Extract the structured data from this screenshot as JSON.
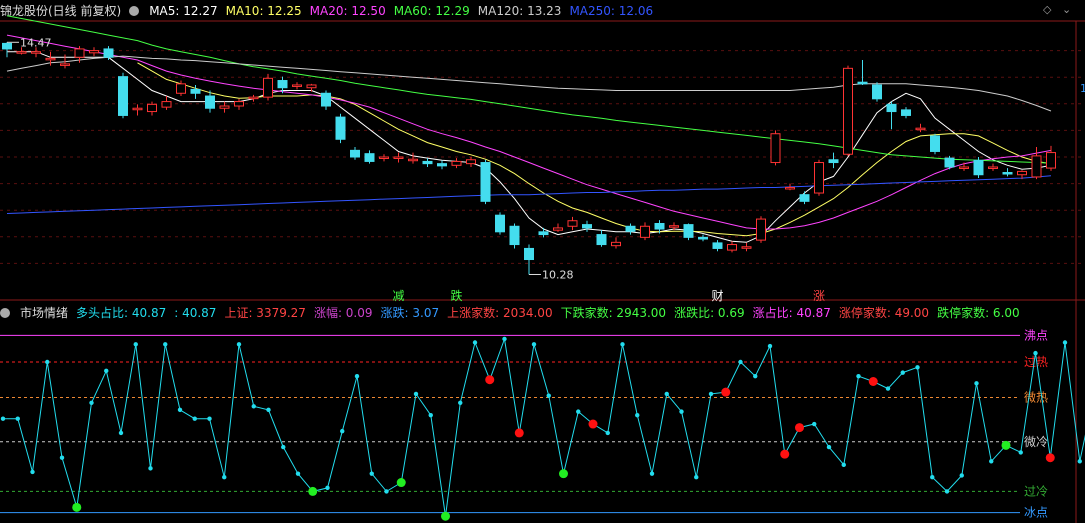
{
  "top": {
    "title": "锦龙股份(日线 前复权)",
    "ma": [
      {
        "label": "MA5: 12.27",
        "color": "#ffffff"
      },
      {
        "label": "MA10: 12.25",
        "color": "#ffff66"
      },
      {
        "label": "MA20: 12.50",
        "color": "#ff44ff"
      },
      {
        "label": "MA60: 12.29",
        "color": "#44ff44"
      },
      {
        "label": "MA120: 13.23",
        "color": "#cccccc"
      },
      {
        "label": "MA250: 12.06",
        "color": "#3355ff"
      }
    ],
    "high_label": "14.47",
    "low_label": "10.28",
    "events": [
      {
        "label": "减",
        "color": "#44ff44",
        "bar": 27
      },
      {
        "label": "跌",
        "color": "#44ff44",
        "bar": 31
      },
      {
        "label": "财",
        "color": "#ffffff",
        "bar": 49
      },
      {
        "label": "涨",
        "color": "#ff4444",
        "bar": 56
      }
    ],
    "right_marker": "1"
  },
  "bottom": {
    "title": "市场情绪",
    "stats": [
      {
        "label": "多头占比: 40.87",
        "color": "#22ddee"
      },
      {
        "label": ": 40.87",
        "color": "#22ddee"
      },
      {
        "label": "上证: 3379.27",
        "color": "#ff4444"
      },
      {
        "label": "涨幅: 0.09",
        "color": "#cc44cc"
      },
      {
        "label": "涨跌: 3.07",
        "color": "#3399ff"
      },
      {
        "label": "上涨家数: 2034.00",
        "color": "#ff4444"
      },
      {
        "label": "下跌家数: 2943.00",
        "color": "#44ff44"
      },
      {
        "label": "涨跌比: 0.69",
        "color": "#44ff44"
      },
      {
        "label": "涨占比: 40.87",
        "color": "#ff44ff"
      },
      {
        "label": "涨停家数: 49.00",
        "color": "#ff4444"
      },
      {
        "label": "跌停家数: 6.00",
        "color": "#44ff44"
      }
    ],
    "levels": [
      {
        "label": "沸点",
        "value": 100,
        "color": "#ff44ff"
      },
      {
        "label": "过热",
        "value": 85,
        "color": "#ff2222"
      },
      {
        "label": "微热",
        "value": 65,
        "color": "#ee8833"
      },
      {
        "label": "微冷",
        "value": 40,
        "color": "#cccccc"
      },
      {
        "label": "过冷",
        "value": 12,
        "color": "#33aa33"
      },
      {
        "label": "冰点",
        "value": 0,
        "color": "#3399ff"
      }
    ]
  },
  "chart_data": [
    {
      "type": "candlestick",
      "ylim": [
        10.0,
        14.8
      ],
      "labels": {
        "high": "14.47",
        "low": "10.28"
      },
      "candles": [
        [
          14.45,
          14.35,
          14.47,
          14.2
        ],
        [
          14.3,
          14.3,
          14.38,
          14.25
        ],
        [
          14.3,
          14.3,
          14.38,
          14.2
        ],
        [
          14.18,
          14.18,
          14.3,
          14.05
        ],
        [
          14.08,
          14.08,
          14.25,
          14.0
        ],
        [
          14.2,
          14.35,
          14.4,
          14.1
        ],
        [
          14.28,
          14.32,
          14.38,
          14.22
        ],
        [
          14.35,
          14.2,
          14.4,
          14.15
        ],
        [
          13.85,
          13.15,
          13.92,
          13.1
        ],
        [
          13.28,
          13.28,
          13.35,
          13.15
        ],
        [
          13.22,
          13.35,
          13.4,
          13.15
        ],
        [
          13.3,
          13.4,
          13.5,
          13.25
        ],
        [
          13.55,
          13.72,
          13.78,
          13.5
        ],
        [
          13.62,
          13.55,
          13.7,
          13.45
        ],
        [
          13.5,
          13.28,
          13.6,
          13.2
        ],
        [
          13.28,
          13.32,
          13.4,
          13.2
        ],
        [
          13.32,
          13.4,
          13.45,
          13.25
        ],
        [
          13.48,
          13.48,
          13.52,
          13.4
        ],
        [
          13.48,
          13.82,
          13.9,
          13.42
        ],
        [
          13.78,
          13.65,
          13.85,
          13.55
        ],
        [
          13.7,
          13.7,
          13.75,
          13.62
        ],
        [
          13.65,
          13.7,
          13.72,
          13.58
        ],
        [
          13.55,
          13.32,
          13.6,
          13.25
        ],
        [
          13.12,
          12.72,
          13.18,
          12.65
        ],
        [
          12.52,
          12.4,
          12.58,
          12.35
        ],
        [
          12.46,
          12.32,
          12.52,
          12.28
        ],
        [
          12.38,
          12.4,
          12.45,
          12.32
        ],
        [
          12.4,
          12.4,
          12.48,
          12.3
        ],
        [
          12.36,
          12.36,
          12.48,
          12.28
        ],
        [
          12.32,
          12.28,
          12.38,
          12.22
        ],
        [
          12.28,
          12.24,
          12.34,
          12.18
        ],
        [
          12.25,
          12.32,
          12.38,
          12.2
        ],
        [
          12.28,
          12.35,
          12.4,
          12.22
        ],
        [
          12.3,
          11.6,
          12.35,
          11.55
        ],
        [
          11.35,
          11.05,
          11.4,
          11.0
        ],
        [
          11.15,
          10.82,
          11.2,
          10.75
        ],
        [
          10.75,
          10.55,
          10.82,
          10.28
        ],
        [
          11.05,
          11.0,
          11.12,
          10.95
        ],
        [
          11.08,
          11.12,
          11.2,
          11.05
        ],
        [
          11.15,
          11.25,
          11.32,
          11.08
        ],
        [
          11.18,
          11.12,
          11.25,
          11.05
        ],
        [
          11.0,
          10.82,
          11.08,
          10.78
        ],
        [
          10.8,
          10.86,
          10.95,
          10.75
        ],
        [
          11.15,
          11.06,
          11.2,
          11.0
        ],
        [
          10.95,
          11.15,
          11.22,
          10.9
        ],
        [
          11.2,
          11.1,
          11.26,
          11.02
        ],
        [
          11.15,
          11.16,
          11.22,
          11.08
        ],
        [
          11.18,
          10.95,
          11.2,
          10.9
        ],
        [
          10.95,
          10.92,
          11.0,
          10.88
        ],
        [
          10.85,
          10.75,
          10.9,
          10.7
        ],
        [
          10.72,
          10.82,
          10.88,
          10.68
        ],
        [
          10.76,
          10.78,
          10.85,
          10.7
        ],
        [
          10.9,
          11.28,
          11.33,
          10.85
        ],
        [
          12.3,
          12.82,
          12.88,
          12.25
        ],
        [
          11.85,
          11.85,
          11.92,
          11.8
        ],
        [
          11.72,
          11.6,
          11.78,
          11.55
        ],
        [
          11.75,
          12.3,
          12.35,
          11.7
        ],
        [
          12.35,
          12.3,
          12.48,
          12.2
        ],
        [
          12.45,
          14.0,
          14.05,
          12.42
        ],
        [
          13.75,
          13.72,
          14.15,
          13.7
        ],
        [
          13.7,
          13.45,
          13.75,
          13.4
        ],
        [
          13.35,
          13.22,
          13.4,
          12.9
        ],
        [
          13.25,
          13.15,
          13.3,
          13.1
        ],
        [
          12.92,
          12.92,
          13.0,
          12.85
        ],
        [
          12.78,
          12.5,
          12.82,
          12.45
        ],
        [
          12.38,
          12.22,
          12.42,
          12.18
        ],
        [
          12.22,
          12.22,
          12.3,
          12.15
        ],
        [
          12.34,
          12.08,
          12.4,
          12.02
        ],
        [
          12.2,
          12.22,
          12.28,
          12.15
        ],
        [
          12.12,
          12.1,
          12.2,
          12.05
        ],
        [
          12.08,
          12.14,
          12.16,
          12.0
        ],
        [
          12.04,
          12.42,
          12.58,
          12.0
        ],
        [
          12.2,
          12.48,
          12.6,
          12.15
        ]
      ],
      "ma_series": [
        {
          "name": "MA5",
          "color": "#ffffff",
          "values": [
            14.3,
            14.3,
            14.3,
            14.2,
            14.2,
            14.2,
            14.2,
            14.2,
            14.0,
            13.8,
            13.6,
            13.5,
            13.4,
            13.4,
            13.4,
            13.4,
            13.4,
            13.45,
            13.55,
            13.6,
            13.6,
            13.6,
            13.5,
            13.3,
            13.1,
            12.9,
            12.7,
            12.5,
            12.42,
            12.38,
            12.34,
            12.32,
            12.3,
            12.2,
            11.95,
            11.65,
            11.3,
            11.1,
            11.0,
            11.05,
            11.1,
            11.08,
            11.05,
            11.05,
            11.02,
            11.05,
            11.1,
            11.08,
            11.02,
            10.95,
            10.88,
            10.86,
            10.98,
            11.25,
            11.5,
            11.75,
            11.95,
            12.05,
            12.4,
            12.8,
            13.2,
            13.4,
            13.55,
            13.45,
            13.1,
            12.9,
            12.7,
            12.5,
            12.35,
            12.25,
            12.18,
            12.2,
            12.25
          ]
        },
        {
          "name": "MA10",
          "color": "#ffff66",
          "values": [
            null,
            null,
            null,
            null,
            null,
            null,
            null,
            null,
            null,
            14.1,
            13.95,
            13.8,
            13.72,
            13.64,
            13.56,
            13.5,
            13.46,
            13.47,
            13.5,
            13.5,
            13.5,
            13.52,
            13.5,
            13.45,
            13.35,
            13.2,
            13.05,
            12.9,
            12.78,
            12.66,
            12.58,
            12.5,
            12.44,
            12.36,
            12.25,
            12.1,
            11.92,
            11.75,
            11.6,
            11.48,
            11.4,
            11.3,
            11.2,
            11.12,
            11.06,
            11.05,
            11.06,
            11.06,
            11.05,
            11.02,
            11.0,
            10.98,
            11.02,
            11.1,
            11.22,
            11.35,
            11.5,
            11.65,
            11.85,
            12.08,
            12.3,
            12.5,
            12.68,
            12.78,
            12.8,
            12.82,
            12.82,
            12.78,
            12.65,
            12.52,
            12.4,
            12.32,
            12.28
          ]
        },
        {
          "name": "MA20",
          "color": "#ff44ff",
          "values": [
            14.6,
            14.55,
            14.5,
            14.45,
            14.4,
            14.35,
            14.3,
            14.25,
            14.2,
            14.15,
            14.05,
            13.95,
            13.88,
            13.82,
            13.77,
            13.72,
            13.68,
            13.64,
            13.61,
            13.58,
            13.55,
            13.52,
            13.48,
            13.43,
            13.37,
            13.3,
            13.2,
            13.1,
            13.0,
            12.9,
            12.82,
            12.75,
            12.67,
            12.58,
            12.5,
            12.4,
            12.3,
            12.2,
            12.1,
            12.0,
            11.9,
            11.82,
            11.74,
            11.66,
            11.58,
            11.5,
            11.42,
            11.36,
            11.3,
            11.24,
            11.18,
            11.12,
            11.1,
            11.1,
            11.12,
            11.16,
            11.22,
            11.3,
            11.4,
            11.5,
            11.6,
            11.72,
            11.85,
            11.98,
            12.1,
            12.2,
            12.28,
            12.33,
            12.37,
            12.4,
            12.42,
            12.47,
            12.52
          ]
        },
        {
          "name": "MA60",
          "color": "#44ff44",
          "values": [
            14.95,
            14.9,
            14.85,
            14.8,
            14.75,
            14.7,
            14.65,
            14.6,
            14.55,
            14.5,
            14.42,
            14.35,
            14.3,
            14.25,
            14.2,
            14.14,
            14.08,
            14.03,
            13.99,
            13.95,
            13.9,
            13.86,
            13.82,
            13.78,
            13.73,
            13.69,
            13.65,
            13.61,
            13.57,
            13.53,
            13.5,
            13.47,
            13.44,
            13.4,
            13.36,
            13.32,
            13.28,
            13.24,
            13.2,
            13.16,
            13.13,
            13.1,
            13.06,
            13.03,
            13.0,
            12.97,
            12.94,
            12.91,
            12.88,
            12.85,
            12.82,
            12.79,
            12.76,
            12.73,
            12.7,
            12.67,
            12.64,
            12.6,
            12.56,
            12.52,
            12.48,
            12.44,
            12.42,
            12.4,
            12.38,
            12.36,
            12.35,
            12.34,
            12.33,
            12.32,
            12.31,
            12.3,
            12.29
          ]
        },
        {
          "name": "MA120",
          "color": "#cccccc",
          "values": [
            13.95,
            14.0,
            14.05,
            14.1,
            14.12,
            14.15,
            14.18,
            14.2,
            14.22,
            14.2,
            14.18,
            14.17,
            14.15,
            14.14,
            14.12,
            14.1,
            14.08,
            14.06,
            14.04,
            14.02,
            14.0,
            13.98,
            13.96,
            13.94,
            13.92,
            13.9,
            13.88,
            13.86,
            13.84,
            13.82,
            13.8,
            13.78,
            13.76,
            13.74,
            13.72,
            13.7,
            13.68,
            13.66,
            13.64,
            13.63,
            13.62,
            13.61,
            13.6,
            13.6,
            13.6,
            13.6,
            13.6,
            13.6,
            13.6,
            13.6,
            13.6,
            13.6,
            13.6,
            13.6,
            13.6,
            13.62,
            13.64,
            13.66,
            13.7,
            13.72,
            13.72,
            13.72,
            13.72,
            13.7,
            13.68,
            13.66,
            13.63,
            13.6,
            13.55,
            13.5,
            13.42,
            13.33,
            13.23
          ]
        },
        {
          "name": "MA250",
          "color": "#3355ff",
          "values": [
            11.38,
            11.39,
            11.4,
            11.41,
            11.42,
            11.43,
            11.44,
            11.45,
            11.46,
            11.47,
            11.48,
            11.49,
            11.5,
            11.51,
            11.52,
            11.53,
            11.54,
            11.55,
            11.56,
            11.57,
            11.58,
            11.59,
            11.6,
            11.61,
            11.62,
            11.63,
            11.64,
            11.65,
            11.66,
            11.67,
            11.68,
            11.69,
            11.7,
            11.71,
            11.72,
            11.72,
            11.72,
            11.73,
            11.74,
            11.75,
            11.76,
            11.76,
            11.77,
            11.78,
            11.79,
            11.8,
            11.8,
            11.81,
            11.82,
            11.82,
            11.83,
            11.84,
            11.85,
            11.85,
            11.86,
            11.87,
            11.88,
            11.89,
            11.9,
            11.91,
            11.92,
            11.93,
            11.94,
            11.95,
            11.96,
            11.97,
            11.98,
            11.99,
            12.0,
            12.01,
            12.02,
            12.04,
            12.06
          ]
        }
      ]
    },
    {
      "type": "line",
      "name": "市场情绪",
      "ylim": [
        -3,
        107
      ],
      "values": [
        53,
        53,
        23,
        85,
        31,
        3,
        62,
        80,
        45,
        95,
        25,
        95,
        58,
        53,
        53,
        20,
        95,
        60,
        58,
        37,
        22,
        12,
        14,
        46,
        77,
        22,
        12,
        17,
        67,
        55,
        -2,
        62,
        96,
        75,
        98,
        45,
        95,
        66,
        22,
        57,
        50,
        45,
        95,
        55,
        22,
        67,
        57,
        20,
        67,
        68,
        85,
        77,
        94,
        33,
        48,
        50,
        37,
        27,
        77,
        74,
        70,
        79,
        82,
        20,
        12,
        21,
        73,
        29,
        38,
        34,
        90,
        31,
        96,
        29,
        68,
        72,
        32
      ],
      "markers": {
        "red": [
          33,
          35,
          40,
          49,
          53,
          54,
          59,
          71
        ],
        "green": [
          5,
          21,
          27,
          30,
          38,
          68
        ]
      }
    }
  ]
}
